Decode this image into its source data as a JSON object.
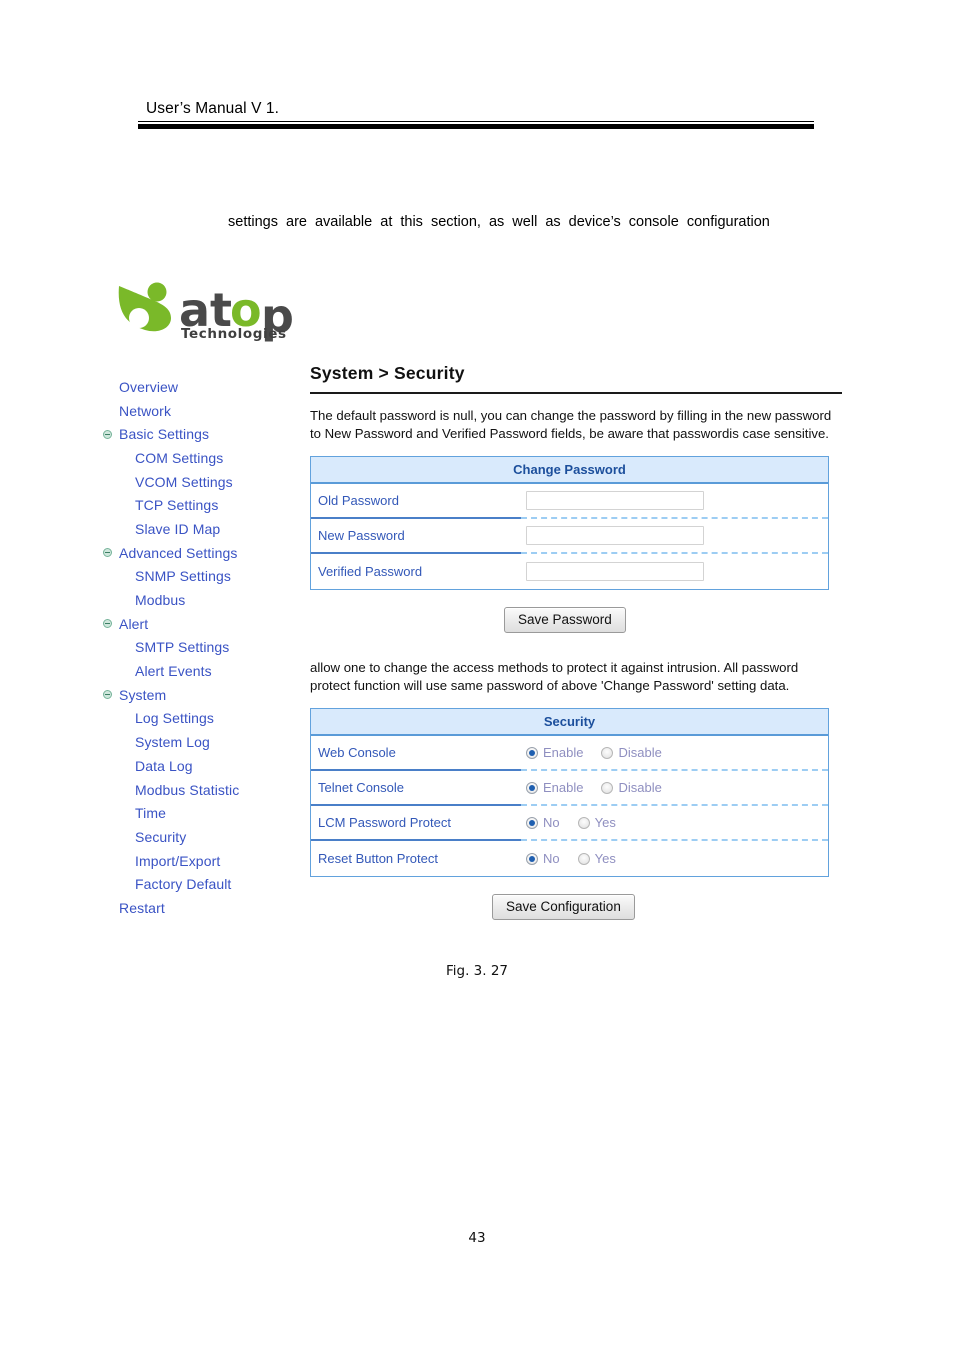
{
  "document": {
    "running_head": "User’s Manual V 1.",
    "intro_text": "settings  are  available  at  this  section,  as  well  as  device’s  console  configuration",
    "figure_caption": "Fig. 3. 27",
    "page_number": "43"
  },
  "logo": {
    "wordmark": "atop",
    "tagline": "Technologies",
    "mark_color": "#7ab929",
    "text_color": "#4a4a4a",
    "accent_color": "#7ab929"
  },
  "sidebar": {
    "items": [
      {
        "label": "Overview",
        "level": 0,
        "bullet": false
      },
      {
        "label": "Network",
        "level": 0,
        "bullet": false
      },
      {
        "label": "Basic Settings",
        "level": 0,
        "bullet": true
      },
      {
        "label": "COM Settings",
        "level": 1,
        "bullet": false
      },
      {
        "label": "VCOM Settings",
        "level": 1,
        "bullet": false
      },
      {
        "label": "TCP Settings",
        "level": 1,
        "bullet": false
      },
      {
        "label": "Slave ID Map",
        "level": 1,
        "bullet": false
      },
      {
        "label": "Advanced Settings",
        "level": 0,
        "bullet": true
      },
      {
        "label": "SNMP Settings",
        "level": 1,
        "bullet": false
      },
      {
        "label": "Modbus",
        "level": 1,
        "bullet": false
      },
      {
        "label": "Alert",
        "level": 0,
        "bullet": true
      },
      {
        "label": "SMTP Settings",
        "level": 1,
        "bullet": false
      },
      {
        "label": "Alert Events",
        "level": 1,
        "bullet": false
      },
      {
        "label": "System",
        "level": 0,
        "bullet": true
      },
      {
        "label": "Log Settings",
        "level": 1,
        "bullet": false
      },
      {
        "label": "System Log",
        "level": 1,
        "bullet": false
      },
      {
        "label": "Data Log",
        "level": 1,
        "bullet": false
      },
      {
        "label": "Modbus Statistic",
        "level": 1,
        "bullet": false
      },
      {
        "label": "Time",
        "level": 1,
        "bullet": false
      },
      {
        "label": "Security",
        "level": 1,
        "bullet": false
      },
      {
        "label": "Import/Export",
        "level": 1,
        "bullet": false
      },
      {
        "label": "Factory Default",
        "level": 1,
        "bullet": false
      },
      {
        "label": "Restart",
        "level": 0,
        "bullet": false
      }
    ],
    "link_color": "#3a53c4"
  },
  "main": {
    "title": "System > Security",
    "password_desc": "The default password is null, you can change the password by filling in the new password to New Password and Verified Password fields, be aware that passwordis case sensitive.",
    "security_desc": "allow one to change the access methods to protect it against intrusion. All password protect function will use same password of above 'Change Password' setting data.",
    "change_password": {
      "header": "Change Password",
      "rows": [
        {
          "label": "Old Password",
          "value": "",
          "placeholder": ""
        },
        {
          "label": "New Password",
          "value": "",
          "placeholder": ""
        },
        {
          "label": "Verified Password",
          "value": "",
          "placeholder": ""
        }
      ],
      "save_label": "Save Password"
    },
    "security": {
      "header": "Security",
      "rows": [
        {
          "label": "Web Console",
          "options": [
            "Enable",
            "Disable"
          ],
          "selected": "Enable"
        },
        {
          "label": "Telnet Console",
          "options": [
            "Enable",
            "Disable"
          ],
          "selected": "Enable"
        },
        {
          "label": "LCM Password Protect",
          "options": [
            "No",
            "Yes"
          ],
          "selected": "No"
        },
        {
          "label": "Reset Button Protect",
          "options": [
            "No",
            "Yes"
          ],
          "selected": "No"
        }
      ],
      "save_label": "Save Configuration"
    },
    "colors": {
      "table_border": "#62a2dd",
      "table_header_bg": "#d9eafc",
      "table_header_text": "#1c4f9c",
      "row_label_text": "#3358b8",
      "radio_label_text": "#8f8fc0",
      "radio_selected": "#1f5fb0"
    }
  }
}
